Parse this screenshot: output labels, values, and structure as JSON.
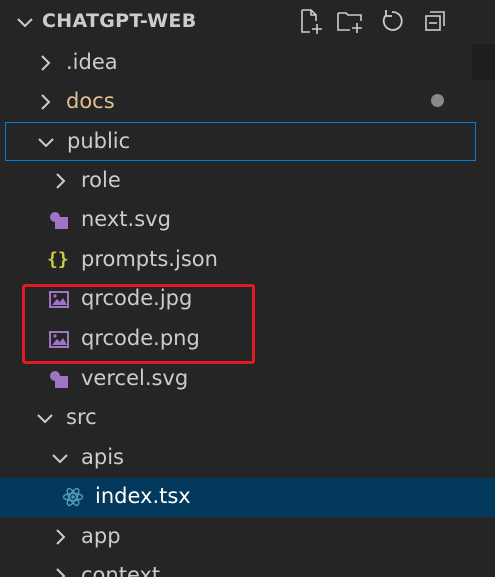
{
  "explorer": {
    "title": "CHATGPT-WEB",
    "actions": [
      "new-file-icon",
      "new-folder-icon",
      "refresh-icon",
      "collapse-all-icon"
    ]
  },
  "tree": {
    "idea": ".idea",
    "docs": "docs",
    "public": "public",
    "role": "role",
    "next_svg": "next.svg",
    "prompts_json": "prompts.json",
    "qrcode_jpg": "qrcode.jpg",
    "qrcode_png": "qrcode.png",
    "vercel_svg": "vercel.svg",
    "src": "src",
    "apis": "apis",
    "index_tsx": "index.tsx",
    "app": "app",
    "context": "context"
  },
  "colors": {
    "background": "#252526",
    "selection_border": "#007fd4",
    "active_row": "#04395e",
    "modified_folder": "#e2c08d",
    "highlight_box": "#e01b24"
  }
}
